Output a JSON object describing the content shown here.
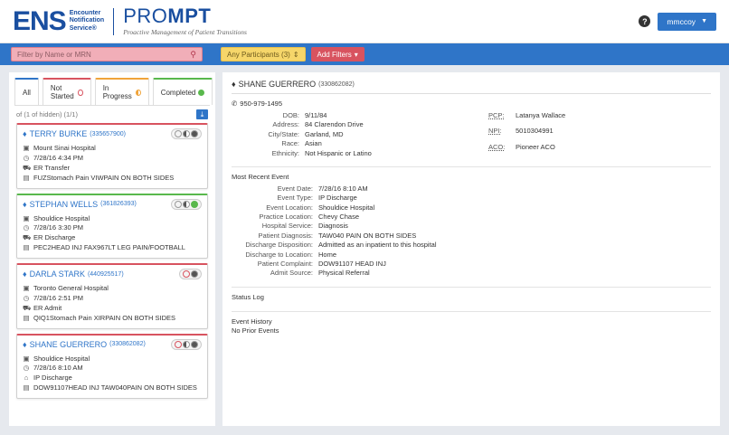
{
  "header": {
    "logo_ens": "ENS",
    "logo_sub": [
      "Encounter",
      "Notification",
      "Service®"
    ],
    "logo_prompt_pre": "PRO",
    "logo_prompt_bold": "MPT",
    "logo_tagline": "Proactive Management of Patient Transitions",
    "help_icon": "question-circle-icon",
    "user_label": "mmccoy"
  },
  "filterbar": {
    "search_placeholder": "Filter by Name or MRN",
    "participants_label": "Any Participants (3)",
    "add_filters_label": "Add Filters"
  },
  "tabs": [
    {
      "label": "All"
    },
    {
      "label": "Not Started"
    },
    {
      "label": "In Progress"
    },
    {
      "label": "Completed"
    }
  ],
  "list": {
    "count_text": "of (1 of hidden) (1/1)",
    "download_icon": "download-icon"
  },
  "patients": [
    {
      "name": "TERRY BURKE",
      "mrn": "(335657900)",
      "facility": "Mount Sinai Hospital",
      "datetime": "7/28/16 4:34 PM",
      "event": "ER Transfer",
      "diagnosis": "FUZStomach Pain VIWPAIN ON BOTH SIDES"
    },
    {
      "name": "STEPHAN WELLS",
      "mrn": "(361826393)",
      "facility": "Shouldice Hospital",
      "datetime": "7/28/16 3:30 PM",
      "event": "ER Discharge",
      "diagnosis": "PEC2HEAD INJ FAX967LT LEG PAIN/FOOTBALL"
    },
    {
      "name": "DARLA STARK",
      "mrn": "(440925517)",
      "facility": "Toronto General Hospital",
      "datetime": "7/28/16 2:51 PM",
      "event": "ER Admit",
      "diagnosis": "QIQ1Stomach Pain XIRPAIN ON BOTH SIDES"
    },
    {
      "name": "SHANE GUERRERO",
      "mrn": "(330862082)",
      "facility": "Shouldice Hospital",
      "datetime": "7/28/16 8:10 AM",
      "event": "IP Discharge",
      "diagnosis": "DOW91107HEAD INJ TAW040PAIN ON BOTH SIDES"
    }
  ],
  "detail": {
    "name": "SHANE GUERRERO",
    "mrn": "(330862082)",
    "phone": "950-979-1495",
    "demographics": {
      "dob_label": "DOB:",
      "dob": "9/11/84",
      "address_label": "Address:",
      "address": "84 Clarendon Drive",
      "city_label": "City/State:",
      "city": "Garland, MD",
      "race_label": "Race:",
      "race": "Asian",
      "ethnicity_label": "Ethnicity:",
      "ethnicity": "Not Hispanic or Latino"
    },
    "providers": {
      "pcp_label": "PCP:",
      "pcp": "Latanya Wallace",
      "npi_label": "NPI:",
      "npi": "5010304991",
      "aco_label": "ACO:",
      "aco": "Pioneer ACO"
    },
    "event_title": "Most Recent Event",
    "event": {
      "date_label": "Event Date:",
      "date": "7/28/16 8:10 AM",
      "type_label": "Event Type:",
      "type": "IP Discharge",
      "location_label": "Event Location:",
      "location": "Shouldice Hospital",
      "practice_label": "Practice Location:",
      "practice": "Chevy Chase",
      "service_label": "Hospital Service:",
      "service": "Diagnosis",
      "diagnosis_label": "Patient Diagnosis:",
      "diagnosis": "TAW040 PAIN ON BOTH SIDES",
      "disposition_label": "Discharge Disposition:",
      "disposition": "Admitted as an inpatient to this hospital",
      "to_location_label": "Discharge to Location:",
      "to_location": "Home",
      "complaint_label": "Patient Complaint:",
      "complaint": "DOW91107 HEAD INJ",
      "admit_label": "Admit Source:",
      "admit": "Physical Referral"
    },
    "status_log": "Status Log",
    "event_history": "Event History",
    "no_prior": "No Prior Events"
  }
}
